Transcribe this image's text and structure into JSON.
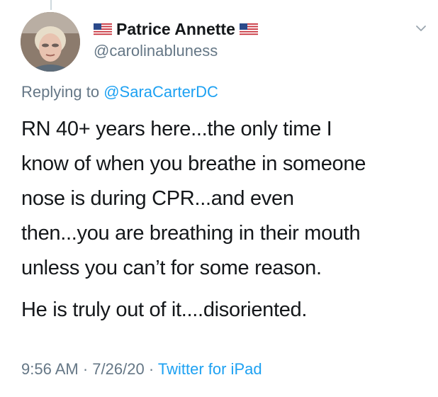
{
  "tweet": {
    "display_name": "Patrice Annette",
    "name_flag_icon": "us-flag-icon",
    "handle": "@carolinabluness",
    "replying_prefix": "Replying to",
    "replying_to": "@SaraCarterDC",
    "paragraphs": [
      "RN 40+ years here...the only time I\nknow of when you breathe in someone\nnose is during CPR...and even\nthen...you are breathing in their mouth\nunless you can’t for some reason.",
      "He is truly out of it....disoriented."
    ],
    "time": "9:56 AM",
    "date": "7/26/20",
    "separator": "·",
    "source": "Twitter for iPad",
    "menu_icon": "chevron-down-icon"
  },
  "colors": {
    "text": "#14171a",
    "secondary": "#657786",
    "link": "#1da1f2",
    "background": "#ffffff"
  }
}
